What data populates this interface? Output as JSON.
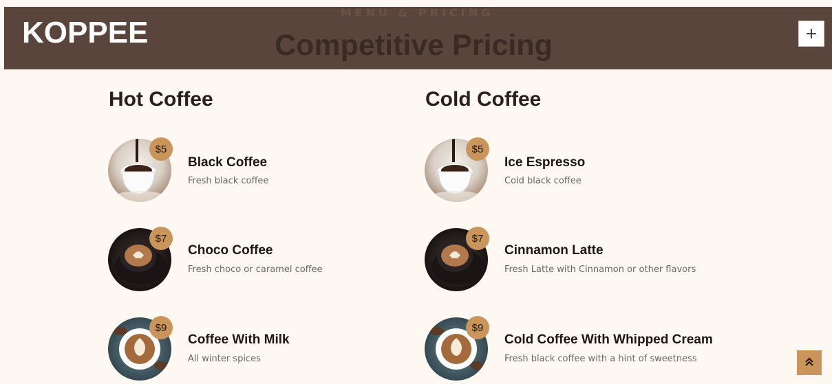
{
  "header": {
    "brand": "KOPPEE",
    "subheading": "MENU & PRICING",
    "heading": "Competitive Pricing",
    "plus_icon": "+"
  },
  "hot": {
    "title": "Hot Coffee",
    "items": [
      {
        "price": "$5",
        "name": "Black Coffee",
        "desc": "Fresh black coffee",
        "image": "coffee-pour-cup"
      },
      {
        "price": "$7",
        "name": "Choco Coffee",
        "desc": "Fresh choco or caramel coffee",
        "image": "latte-art-dark-cup"
      },
      {
        "price": "$9",
        "name": "Coffee With Milk",
        "desc": "All winter spices",
        "image": "latte-with-beans"
      }
    ]
  },
  "cold": {
    "title": "Cold Coffee",
    "items": [
      {
        "price": "$5",
        "name": "Ice Espresso",
        "desc": "Cold black coffee",
        "image": "coffee-pour-cup"
      },
      {
        "price": "$7",
        "name": "Cinnamon Latte",
        "desc": "Fresh Latte with Cinnamon or other flavors",
        "image": "latte-art-dark-cup"
      },
      {
        "price": "$9",
        "name": "Cold Coffee With Whipped Cream",
        "desc": "Fresh black coffee with a hint of sweetness",
        "image": "latte-with-beans"
      }
    ]
  },
  "back_to_top_icon": "double-chevron-up-icon",
  "colors": {
    "topbar": "#5a453c",
    "accent": "#c9955a",
    "background": "#fdf8f1"
  }
}
